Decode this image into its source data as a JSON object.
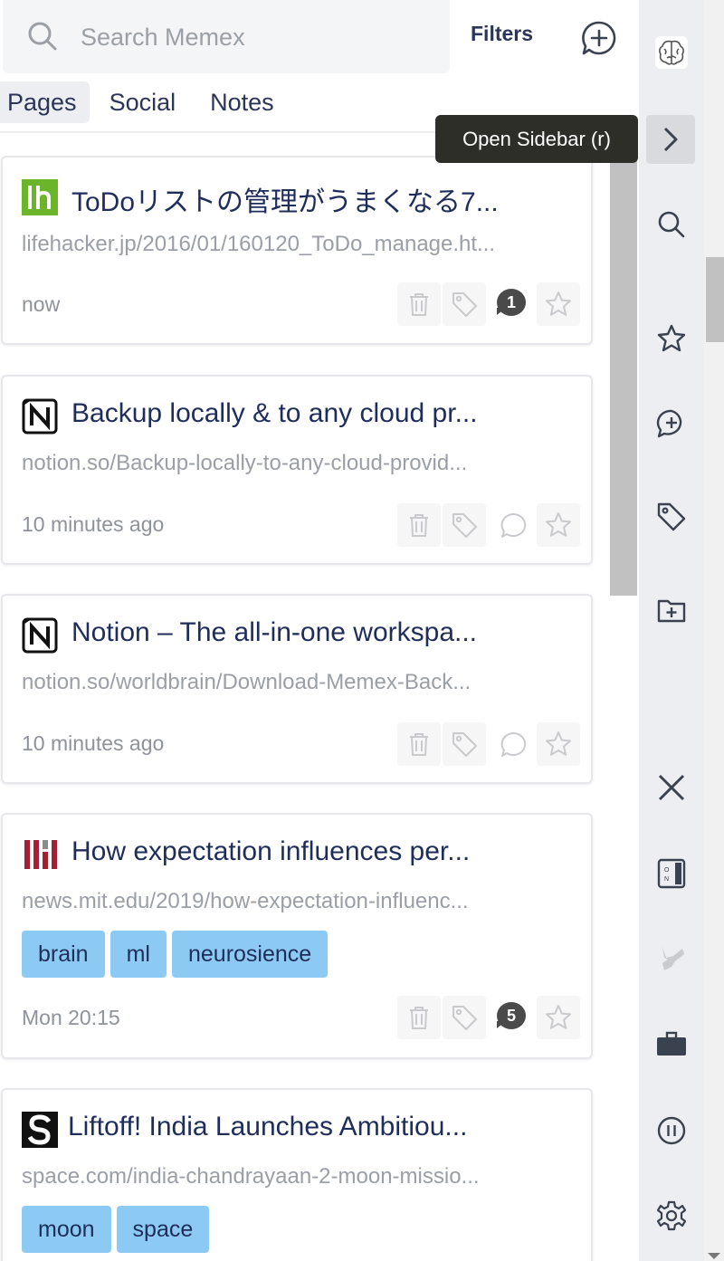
{
  "search": {
    "placeholder": "Search Memex"
  },
  "header": {
    "filters_label": "Filters",
    "add_note_icon": "add-comment-icon"
  },
  "tabs": [
    {
      "label": "Pages",
      "active": true
    },
    {
      "label": "Social",
      "active": false
    },
    {
      "label": "Notes",
      "active": false
    }
  ],
  "tooltip": {
    "text": "Open Sidebar (r)"
  },
  "results": [
    {
      "favicon": "lifehacker-favicon",
      "title": "ToDoリストの管理がうまくなる7...",
      "url": "lifehacker.jp/2016/01/160120_ToDo_manage.ht...",
      "time": "now",
      "tags": [],
      "comment_count": "1"
    },
    {
      "favicon": "notion-favicon",
      "title": "Backup locally & to any cloud pr...",
      "url": "notion.so/Backup-locally-to-any-cloud-provid...",
      "time": "10 minutes ago",
      "tags": [],
      "comment_count": ""
    },
    {
      "favicon": "notion-favicon",
      "title": "Notion – The all-in-one workspa...",
      "url": "notion.so/worldbrain/Download-Memex-Back...",
      "time": "10 minutes ago",
      "tags": [],
      "comment_count": ""
    },
    {
      "favicon": "mit-favicon",
      "title": "How expectation influences per...",
      "url": "news.mit.edu/2019/how-expectation-influenc...",
      "time": "Mon 20:15",
      "tags": [
        "brain",
        "ml",
        "neurosience"
      ],
      "comment_count": "5"
    },
    {
      "favicon": "space-favicon",
      "title": "Liftoff! India Launches Ambitiou...",
      "url": "space.com/india-chandrayaan-2-moon-missio...",
      "time": "",
      "tags": [
        "moon",
        "space"
      ],
      "comment_count": ""
    }
  ],
  "ribbon_icons": [
    "memex-brain-icon",
    "chevron-right-icon",
    "search-icon",
    "star-icon",
    "add-comment-icon",
    "tag-icon",
    "add-to-collection-icon",
    "close-icon",
    "reader-icon",
    "highlighter-icon",
    "toolbox-icon",
    "pause-icon",
    "gear-icon"
  ],
  "colors": {
    "tag_pill": "#8ccaf4",
    "title_text": "#1f2d5a",
    "ribbon_bg": "#edeef2",
    "tooltip_bg": "#2e2e28"
  }
}
